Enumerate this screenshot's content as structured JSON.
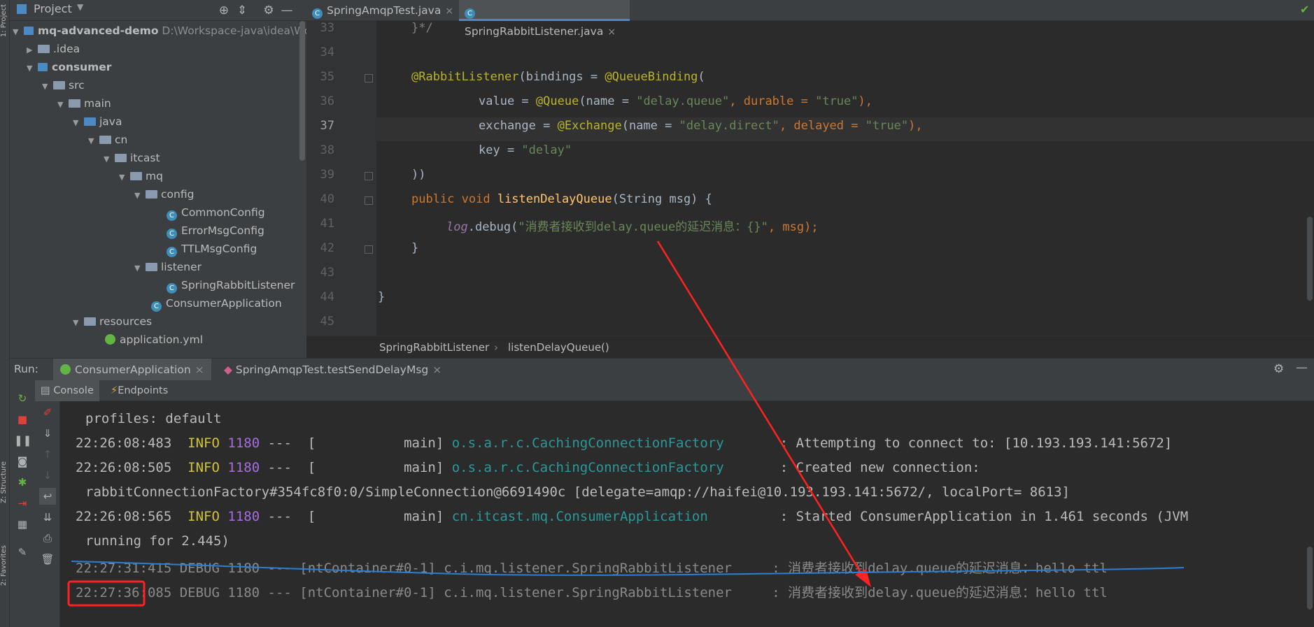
{
  "side_tabs": {
    "project": "1: Project",
    "structure": "Z: Structure",
    "favorites": "2: Favorites"
  },
  "project": {
    "title": "Project",
    "tree": [
      {
        "label": "mq-advanced-demo",
        "path": "D:\\Workspace-java\\idea\\Wor",
        "bold": true
      },
      {
        "label": ".idea"
      },
      {
        "label": "consumer",
        "bold": true
      },
      {
        "label": "src"
      },
      {
        "label": "main"
      },
      {
        "label": "java"
      },
      {
        "label": "cn"
      },
      {
        "label": "itcast"
      },
      {
        "label": "mq"
      },
      {
        "label": "config"
      },
      {
        "label": "CommonConfig"
      },
      {
        "label": "ErrorMsgConfig"
      },
      {
        "label": "TTLMsgConfig"
      },
      {
        "label": "listener"
      },
      {
        "label": "SpringRabbitListener"
      },
      {
        "label": "ConsumerApplication"
      },
      {
        "label": "resources"
      },
      {
        "label": "application.yml"
      }
    ]
  },
  "editor": {
    "tabs": [
      {
        "label": "SpringAmqpTest.java",
        "active": false
      },
      {
        "label": "SpringRabbitListener.java",
        "active": true
      }
    ],
    "line_numbers": [
      "33",
      "34",
      "35",
      "36",
      "37",
      "38",
      "39",
      "40",
      "41",
      "42",
      "43",
      "44",
      "45"
    ],
    "current_line": "37",
    "code": {
      "l33": "}*/",
      "l35_a": "@RabbitListener",
      "l35_b": "(bindings = ",
      "l35_c": "@QueueBinding",
      "l35_d": "(",
      "l36_a": "value = ",
      "l36_b": "@Queue",
      "l36_c": "(name = ",
      "l36_d": "\"delay.queue\"",
      "l36_e": ", durable = ",
      "l36_f": "\"true\"",
      "l36_g": "),",
      "l37_a": "exchange = ",
      "l37_b": "@Exchange",
      "l37_c": "(name = ",
      "l37_d": "\"delay.direct\"",
      "l37_e": ", delayed = ",
      "l37_f": "\"true\"",
      "l37_g": "),",
      "l38_a": "key = ",
      "l38_b": "\"delay\"",
      "l39": "))",
      "l40_a": "public void ",
      "l40_b": "listenDelayQueue",
      "l40_c": "(String msg) {",
      "l41_a": "log",
      "l41_b": ".debug(",
      "l41_c": "\"消费者接收到delay.queue的延迟消息：{}\"",
      "l41_d": ", msg);",
      "l42": "}",
      "l44": "}"
    },
    "breadcrumbs": [
      "SpringRabbitListener",
      "listenDelayQueue()"
    ]
  },
  "run": {
    "label": "Run:",
    "tabs": [
      "ConsumerApplication",
      "SpringAmqpTest.testSendDelayMsg"
    ],
    "subtabs": [
      "Console",
      "Endpoints"
    ],
    "console": [
      {
        "text": "profiles: default"
      },
      {
        "time": "22:26:08:483",
        "level": "INFO",
        "pid": "1180",
        "thread": "---  [           main]",
        "logger": "o.s.a.r.c.CachingConnectionFactory      ",
        "msg": ": Attempting to connect to: [10.193.193.141:5672]"
      },
      {
        "time": "22:26:08:505",
        "level": "INFO",
        "pid": "1180",
        "thread": "---  [           main]",
        "logger": "o.s.a.r.c.CachingConnectionFactory      ",
        "msg": ": Created new connection:"
      },
      {
        "text": "rabbitConnectionFactory#354fc8f0:0/SimpleConnection@6691490c [delegate=amqp://haifei@10.193.193.141:5672/, localPort= 8613]"
      },
      {
        "time": "22:26:08:565",
        "level": "INFO",
        "pid": "1180",
        "thread": "---  [           main]",
        "logger": "cn.itcast.mq.ConsumerApplication        ",
        "msg": ": Started ConsumerApplication in 1.461 seconds (JVM"
      },
      {
        "text": "running for 2.445)"
      },
      {
        "line": "22:27:31:415 DEBUG 1180 --- [ntContainer#0-1] c.i.mq.listener.SpringRabbitListener     : 消费者接收到delay.queue的延迟消息：hello ttl"
      },
      {
        "line": "22:27:36:085 DEBUG 1180 --- [ntContainer#0-1] c.i.mq.listener.SpringRabbitListener     : 消费者接收到delay.queue的延迟消息：hello ttl"
      }
    ]
  },
  "colors": {
    "annotation_red": "#ff2222",
    "underline_blue": "#2a7fd4"
  }
}
